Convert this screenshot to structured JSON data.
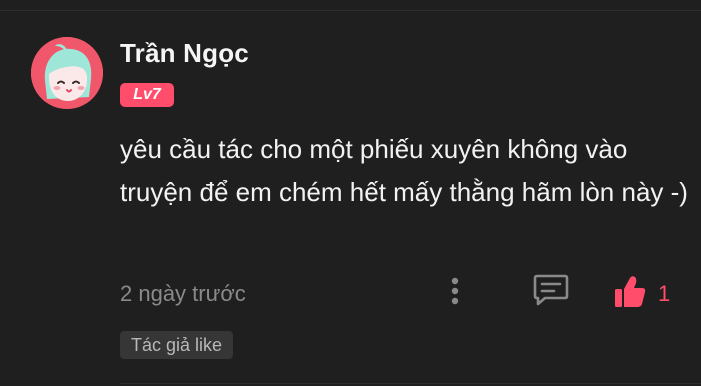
{
  "comment": {
    "author_name": "Trần Ngọc",
    "level": "Lv7",
    "text": "yêu cầu tác cho một phiếu xuyên không vào truyện để em chém hết mấy thằng hãm lòn này -)",
    "timestamp": "2 ngày trước",
    "like_count": "1",
    "author_liked_label": "Tác giả like"
  },
  "colors": {
    "background": "#1f1f1f",
    "accent": "#ff4d6b",
    "muted_text": "#8a8a8a",
    "avatar_bg": "#f0576a",
    "avatar_hair": "#9ee6d8"
  },
  "icons": {
    "more": "more-vertical-icon",
    "reply": "comment-bubble-icon",
    "like": "thumbs-up-icon"
  }
}
